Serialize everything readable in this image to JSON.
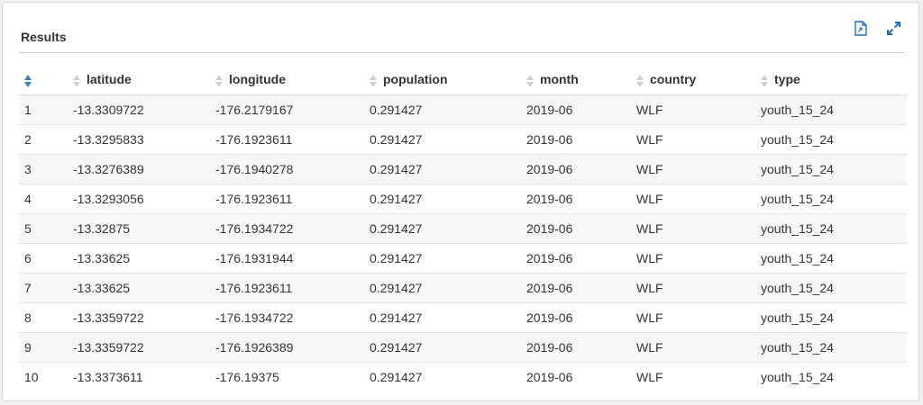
{
  "panel": {
    "title": "Results"
  },
  "toolbar": {
    "export_icon": "export-document-icon",
    "expand_icon": "expand-icon"
  },
  "colors": {
    "accent": "#1f6fbf",
    "sort_active": "#3a7dc9"
  },
  "table": {
    "sorted_column": 0,
    "columns": [
      "",
      "latitude",
      "longitude",
      "population",
      "month",
      "country",
      "type"
    ],
    "rows": [
      [
        "1",
        "-13.3309722",
        "-176.2179167",
        "0.291427",
        "2019-06",
        "WLF",
        "youth_15_24"
      ],
      [
        "2",
        "-13.3295833",
        "-176.1923611",
        "0.291427",
        "2019-06",
        "WLF",
        "youth_15_24"
      ],
      [
        "3",
        "-13.3276389",
        "-176.1940278",
        "0.291427",
        "2019-06",
        "WLF",
        "youth_15_24"
      ],
      [
        "4",
        "-13.3293056",
        "-176.1923611",
        "0.291427",
        "2019-06",
        "WLF",
        "youth_15_24"
      ],
      [
        "5",
        "-13.32875",
        "-176.1934722",
        "0.291427",
        "2019-06",
        "WLF",
        "youth_15_24"
      ],
      [
        "6",
        "-13.33625",
        "-176.1931944",
        "0.291427",
        "2019-06",
        "WLF",
        "youth_15_24"
      ],
      [
        "7",
        "-13.33625",
        "-176.1923611",
        "0.291427",
        "2019-06",
        "WLF",
        "youth_15_24"
      ],
      [
        "8",
        "-13.3359722",
        "-176.1934722",
        "0.291427",
        "2019-06",
        "WLF",
        "youth_15_24"
      ],
      [
        "9",
        "-13.3359722",
        "-176.1926389",
        "0.291427",
        "2019-06",
        "WLF",
        "youth_15_24"
      ],
      [
        "10",
        "-13.3373611",
        "-176.19375",
        "0.291427",
        "2019-06",
        "WLF",
        "youth_15_24"
      ]
    ]
  }
}
